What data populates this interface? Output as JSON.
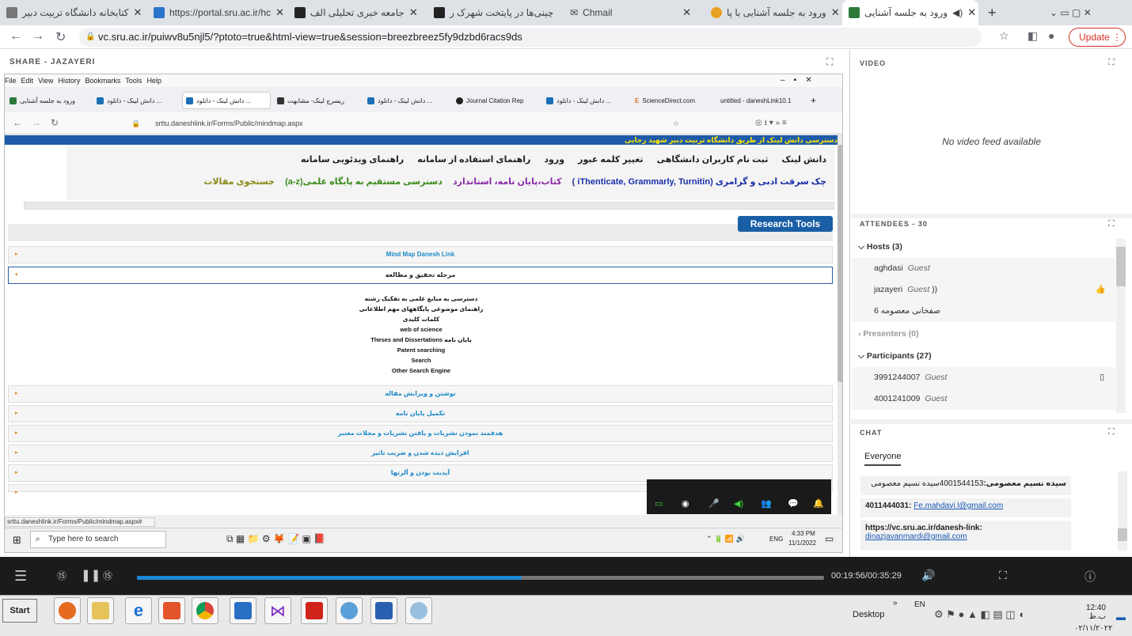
{
  "chrome": {
    "tabs": [
      {
        "label": "کتابخانه دانشگاه تربیت دبیر",
        "color": "#555"
      },
      {
        "label": "https://portal.sru.ac.ir/hc",
        "color": "#2a74c9"
      },
      {
        "label": "جامعه خبری تحلیلی الف",
        "color": "#222"
      },
      {
        "label": "چینی‌ها در پایتخت شهرک ر",
        "color": "#222"
      },
      {
        "label": "Chmail",
        "color": "#444"
      },
      {
        "label": "ورود به جلسه آشنایی با پا",
        "color": "#e8a020"
      },
      {
        "label": "ورود به جلسه آشنایی",
        "color": "#2b7a3a"
      }
    ],
    "url": "vc.sru.ac.ir/puiwv8u5njl5/?ptoto=true&html-view=true&session=breezbreez5fy9dzbd6racs9ds",
    "update_label": "Update"
  },
  "share": {
    "header": "SHARE - JAZAYERI",
    "ff_menu": [
      "File",
      "Edit",
      "View",
      "History",
      "Bookmarks",
      "Tools",
      "Help"
    ],
    "ff_tabs": [
      "ورود به جلسه آشنایی",
      "دانش لینک - دانلود ...",
      "دانش لینک - دانلود ...",
      "دانش لینک - دانلود ...",
      "ریسرچ لینک- مشابهت",
      "دانش لینک - دانلود ...",
      "Journal Citation Rep",
      "دانش لینک - دانلود ...",
      "ScienceDirect.com",
      "untitled - daneshLink10.1"
    ],
    "ff_url": "srttu.daneshlink.ir/Forms/Public/mindmap.aspx",
    "marquee": "دسترسی دانش لینک از طریق دانشگاه تربیت دبیر شهید رجایی",
    "nav1": [
      "دانش لینک",
      "ثبت نام کاربران دانشگاهی",
      "تغییر کلمه عبور",
      "ورود",
      "راهنمای استفاده از سامانه",
      "راهنمای ویدئویی سامانه"
    ],
    "nav2": {
      "a": "چک سرقت ادبی و گرامری (iThenticate, Grammarly, Turnitin )",
      "b": "کتاب،پایان نامه، استاندارد",
      "c": "دسترسی مستقیم به پایگاه علمی(a-z)",
      "d": "جستجوی مقالات"
    },
    "research_tools": "Research Tools",
    "accordion": [
      "Mind Map Danesh Link",
      "مرحله تحقیق و مطالعه",
      "نوشتن و ویرایش مقاله",
      "تکمیل پایان نامه",
      "هدفمند نمودن نشریات و یافتن نشریات و مجلات معتبر",
      "افزایش دیده شدن و ضریب تاثیر",
      "آپدیت بودن و آلرتها"
    ],
    "sub_items": [
      "دسترسی به منابع علمی به تفکیک رشته",
      "راهنمای موضوعی پایگاههای مهم اطلاعاتی",
      "کلمات کلیدی",
      "web of science",
      "Theses and Dissertations پایان نامه",
      "Patent searching",
      "Search",
      "Other Search Engine"
    ],
    "status_url": "srttu.daneshlink.ir/Forms/Public/mindmap.aspx#",
    "win10": {
      "search": "Type here to search",
      "lang": "ENG",
      "time": "4:33 PM",
      "date": "11/1/2022"
    }
  },
  "video": {
    "header": "VIDEO",
    "empty": "No video feed available"
  },
  "attendees": {
    "header": "ATTENDEES - 30",
    "hosts_label": "Hosts (3)",
    "hosts": [
      {
        "name": "aghdasi",
        "role": "Guest"
      },
      {
        "name": "jazayeri",
        "role": "Guest"
      },
      {
        "name": "صفخانی معصومه 6",
        "role": ""
      }
    ],
    "presenters_label": "Presenters (0)",
    "participants_label": "Participants (27)",
    "participants": [
      {
        "name": "3991244007",
        "role": "Guest"
      },
      {
        "name": "4001241009",
        "role": "Guest"
      }
    ]
  },
  "chat": {
    "header": "CHAT",
    "tab": "Everyone",
    "messages": [
      {
        "sender": "سیده نسیم معصومی:",
        "text": "4001544153سیده نسیم معصومی"
      },
      {
        "sender": "4011444031:",
        "text": "Fe.mahdavi.l@gmail.com"
      },
      {
        "sender": "https://vc.sru.ac.ir/danesh-link:",
        "text": "dinazjavanmardi@gmail.com"
      }
    ]
  },
  "player": {
    "time": "00:19:56/00:35:29",
    "progress": 0.56
  },
  "taskbar": {
    "start": "Start",
    "desktop": "Desktop",
    "lang": "EN",
    "time": "12:40 ب.ظ",
    "date": "۰۲/۱۱/۲۰۲۲"
  }
}
